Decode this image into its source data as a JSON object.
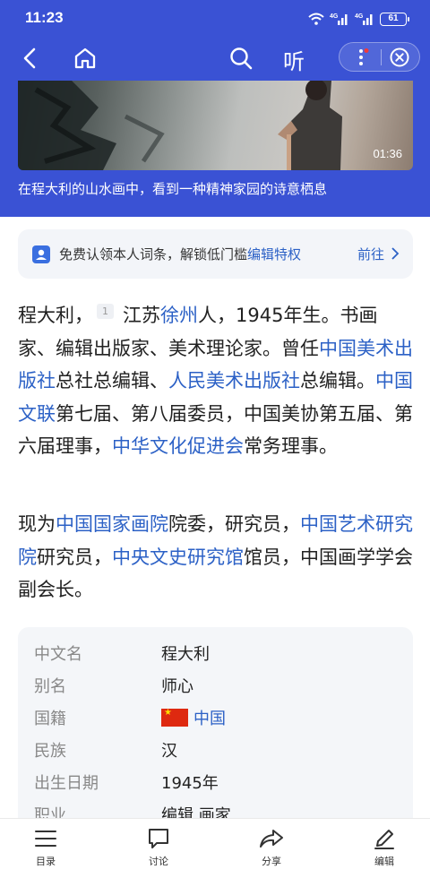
{
  "status": {
    "time": "11:23",
    "battery": "61",
    "net1": "4G",
    "net2": "4G"
  },
  "header": {
    "listen_label": "听"
  },
  "video": {
    "duration": "01:36",
    "caption": "在程大利的山水画中，看到一种精神家园的诗意栖息"
  },
  "claim": {
    "text": "免费认领本人词条，解锁低门槛",
    "link": "编辑特权",
    "go": "前往"
  },
  "paragraph1": {
    "s1": "程大利，",
    "ref": "1",
    "s2": "江苏",
    "l1": "徐州",
    "s3": "人，1945年生。书画家、编辑出版家、美术理论家。曾任",
    "l2": "中国美术出版社",
    "s4": "总社总编辑、",
    "l3": "人民美术出版社",
    "s5": "总编辑。",
    "l4": "中国文联",
    "s6": "第七届、第八届委员，中国美协第五届、第六届理事，",
    "l5": "中华文化促进会",
    "s7": "常务理事。"
  },
  "paragraph2": {
    "s1": "现为",
    "l1": "中国国家画院",
    "s2": "院委，研究员，",
    "l2": "中国艺术研究院",
    "s3": "研究员，",
    "l3": "中央文史研究馆",
    "s4": "馆员，中国画学学会副会长。"
  },
  "infobox": [
    {
      "label": "中文名",
      "value": "程大利"
    },
    {
      "label": "别名",
      "value": "师心"
    },
    {
      "label": "国籍",
      "value": "中国"
    },
    {
      "label": "民族",
      "value": "汉"
    },
    {
      "label": "出生日期",
      "value": "1945年"
    },
    {
      "label": "职业",
      "value": "编辑 画家"
    }
  ],
  "bottom": {
    "catalog": "目录",
    "discuss": "讨论",
    "share": "分享",
    "edit": "编辑"
  }
}
